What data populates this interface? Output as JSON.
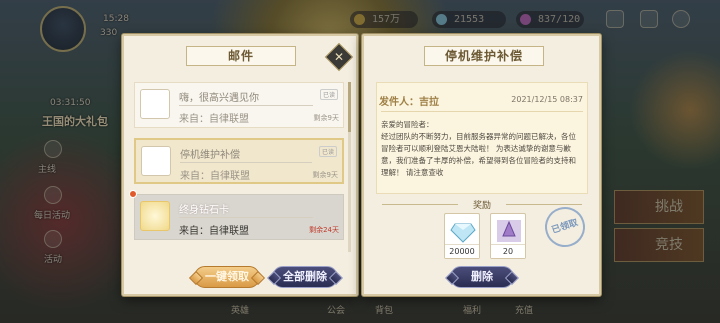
{
  "hud": {
    "time": "15:28",
    "player_id": "330",
    "currency_1": "157万",
    "currency_2": "21553",
    "stamina": "837/120",
    "countdown": "03:31:50",
    "event_banner": "王国的大礼包"
  },
  "sidebar": {
    "items": [
      {
        "label": "主线"
      },
      {
        "label": "每日活动"
      },
      {
        "label": "活动"
      }
    ]
  },
  "right_menu": {
    "items": [
      {
        "label": "挑战"
      },
      {
        "label": "竞技"
      }
    ]
  },
  "bottom_nav": {
    "items": [
      {
        "label": "英雄"
      },
      {
        "label": "公会"
      },
      {
        "label": "背包"
      },
      {
        "label": "福利"
      },
      {
        "label": "充值"
      }
    ]
  },
  "mail_panel": {
    "title": "邮件",
    "tool_icon": "✕",
    "mails": [
      {
        "title": "嗨，很高兴遇见你",
        "from": "来自：自律联盟",
        "expire": "剩余9天",
        "tag": "已读",
        "state": "read"
      },
      {
        "title": "停机维护补偿",
        "from": "来自：自律联盟",
        "expire": "剩余9天",
        "tag": "已读",
        "state": "selected"
      },
      {
        "title": "终身钻石卡",
        "from": "来自：自律联盟",
        "expire": "剩余24天",
        "tag": "",
        "state": "unread"
      }
    ],
    "claim_all_label": "一键领取",
    "delete_all_label": "全部删除"
  },
  "mail_detail": {
    "title": "停机维护补偿",
    "sender": "发件人：吉拉",
    "date": "2021/12/15 08:37",
    "greeting": "亲爱的冒险者：",
    "body": "经过团队的不断努力，目前服务器异常的问题已解决，各位冒险者可以顺利登陆艾恩大陆啦！ 为表达诚挚的谢意与歉意，我们准备了丰厚的补偿，希望得到各位冒险者的支持和理解！ 请注意查收",
    "rewards_label": "奖励",
    "rewards": [
      {
        "icon": "diamond-icon",
        "count": "20000"
      },
      {
        "icon": "scroll-icon",
        "count": "20"
      }
    ],
    "claimed_stamp": "已领取",
    "delete_label": "删除"
  }
}
